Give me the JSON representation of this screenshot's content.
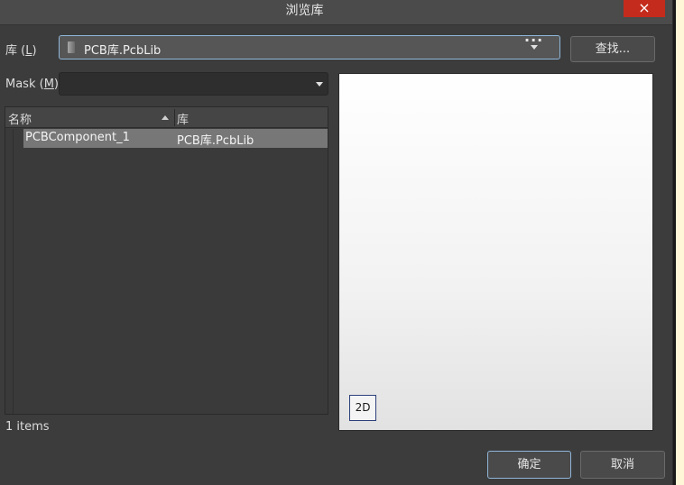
{
  "window": {
    "title": "浏览库",
    "close_glyph": "×"
  },
  "library": {
    "label_main": "库 (",
    "label_key": "L",
    "label_end": ")",
    "value": "PCB库.PcbLib",
    "more_glyph": "···",
    "find_button": "查找..."
  },
  "mask": {
    "label_main": "Mask (",
    "label_key": "M",
    "label_end": ")",
    "value": ""
  },
  "table": {
    "columns": [
      "名称",
      "库"
    ],
    "sort_column": "名称",
    "sort_order": "ascending",
    "rows": [
      {
        "name": "PCBComponent_1",
        "library": "PCB库.PcbLib",
        "selected": true
      }
    ]
  },
  "status": {
    "count_text": "1 items"
  },
  "preview": {
    "mode_button": "2D"
  },
  "footer": {
    "ok_button": "确定",
    "cancel_button": "取消"
  },
  "colors": {
    "background": "#3c3c3c",
    "accent_border": "#8fb6d8",
    "close_red": "#c42b1c",
    "selected_row": "#777777"
  },
  "icons": [
    "library-file-icon",
    "dropdown-arrow-icon",
    "more-options-icon",
    "sort-ascending-icon",
    "close-icon"
  ]
}
